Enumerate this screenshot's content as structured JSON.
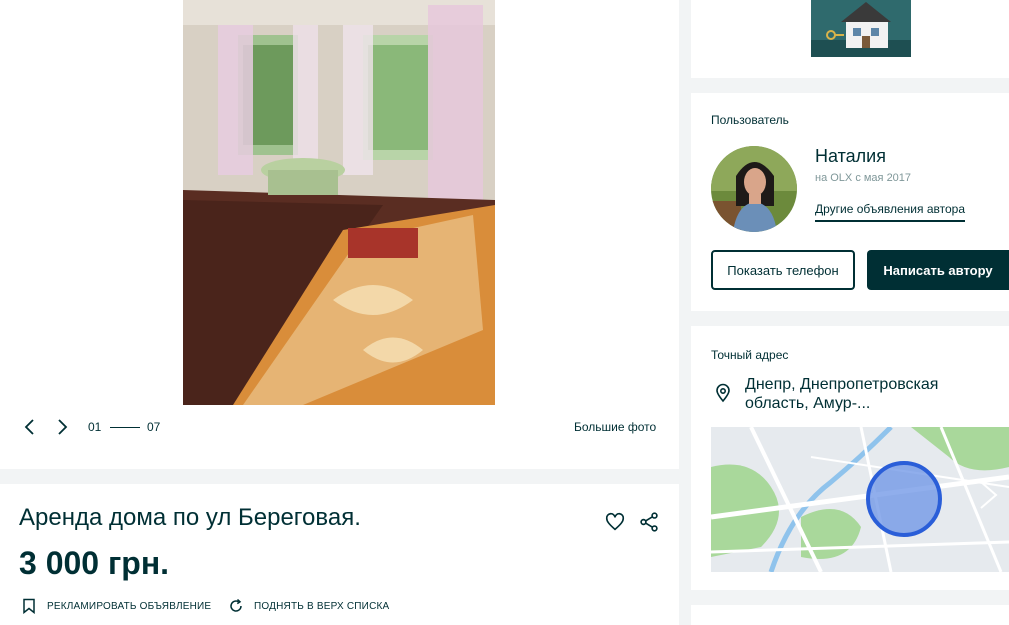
{
  "gallery": {
    "counter_current": "01",
    "counter_total": "07",
    "big_photos_label": "Большие фото"
  },
  "ad": {
    "title": "Аренда дома по ул Береговая.",
    "price": "3 000 грн.",
    "promote_label": "РЕКЛАМИРОВАТЬ ОБЪЯВЛЕНИЕ",
    "raise_label": "ПОДНЯТЬ В ВЕРХ СПИСКА"
  },
  "user": {
    "section_label": "Пользователь",
    "name": "Наталия",
    "since": "на OLX с мая 2017",
    "other_ads_label": "Другие объявления автора",
    "show_phone_label": "Показать телефон",
    "write_label": "Написать автору"
  },
  "location": {
    "section_label": "Точный адрес",
    "address": "Днепр, Днепропетровская область, Амур-..."
  },
  "icons": {
    "prev": "chevron-left-icon",
    "next": "chevron-right-icon",
    "favorite": "heart-icon",
    "share": "share-icon",
    "promote": "bookmark-icon",
    "raise": "refresh-icon",
    "location": "map-pin-icon"
  },
  "colors": {
    "primary": "#002f34",
    "background": "#f2f4f5",
    "muted": "#7f9799",
    "map_marker": "#4a7ee8"
  }
}
